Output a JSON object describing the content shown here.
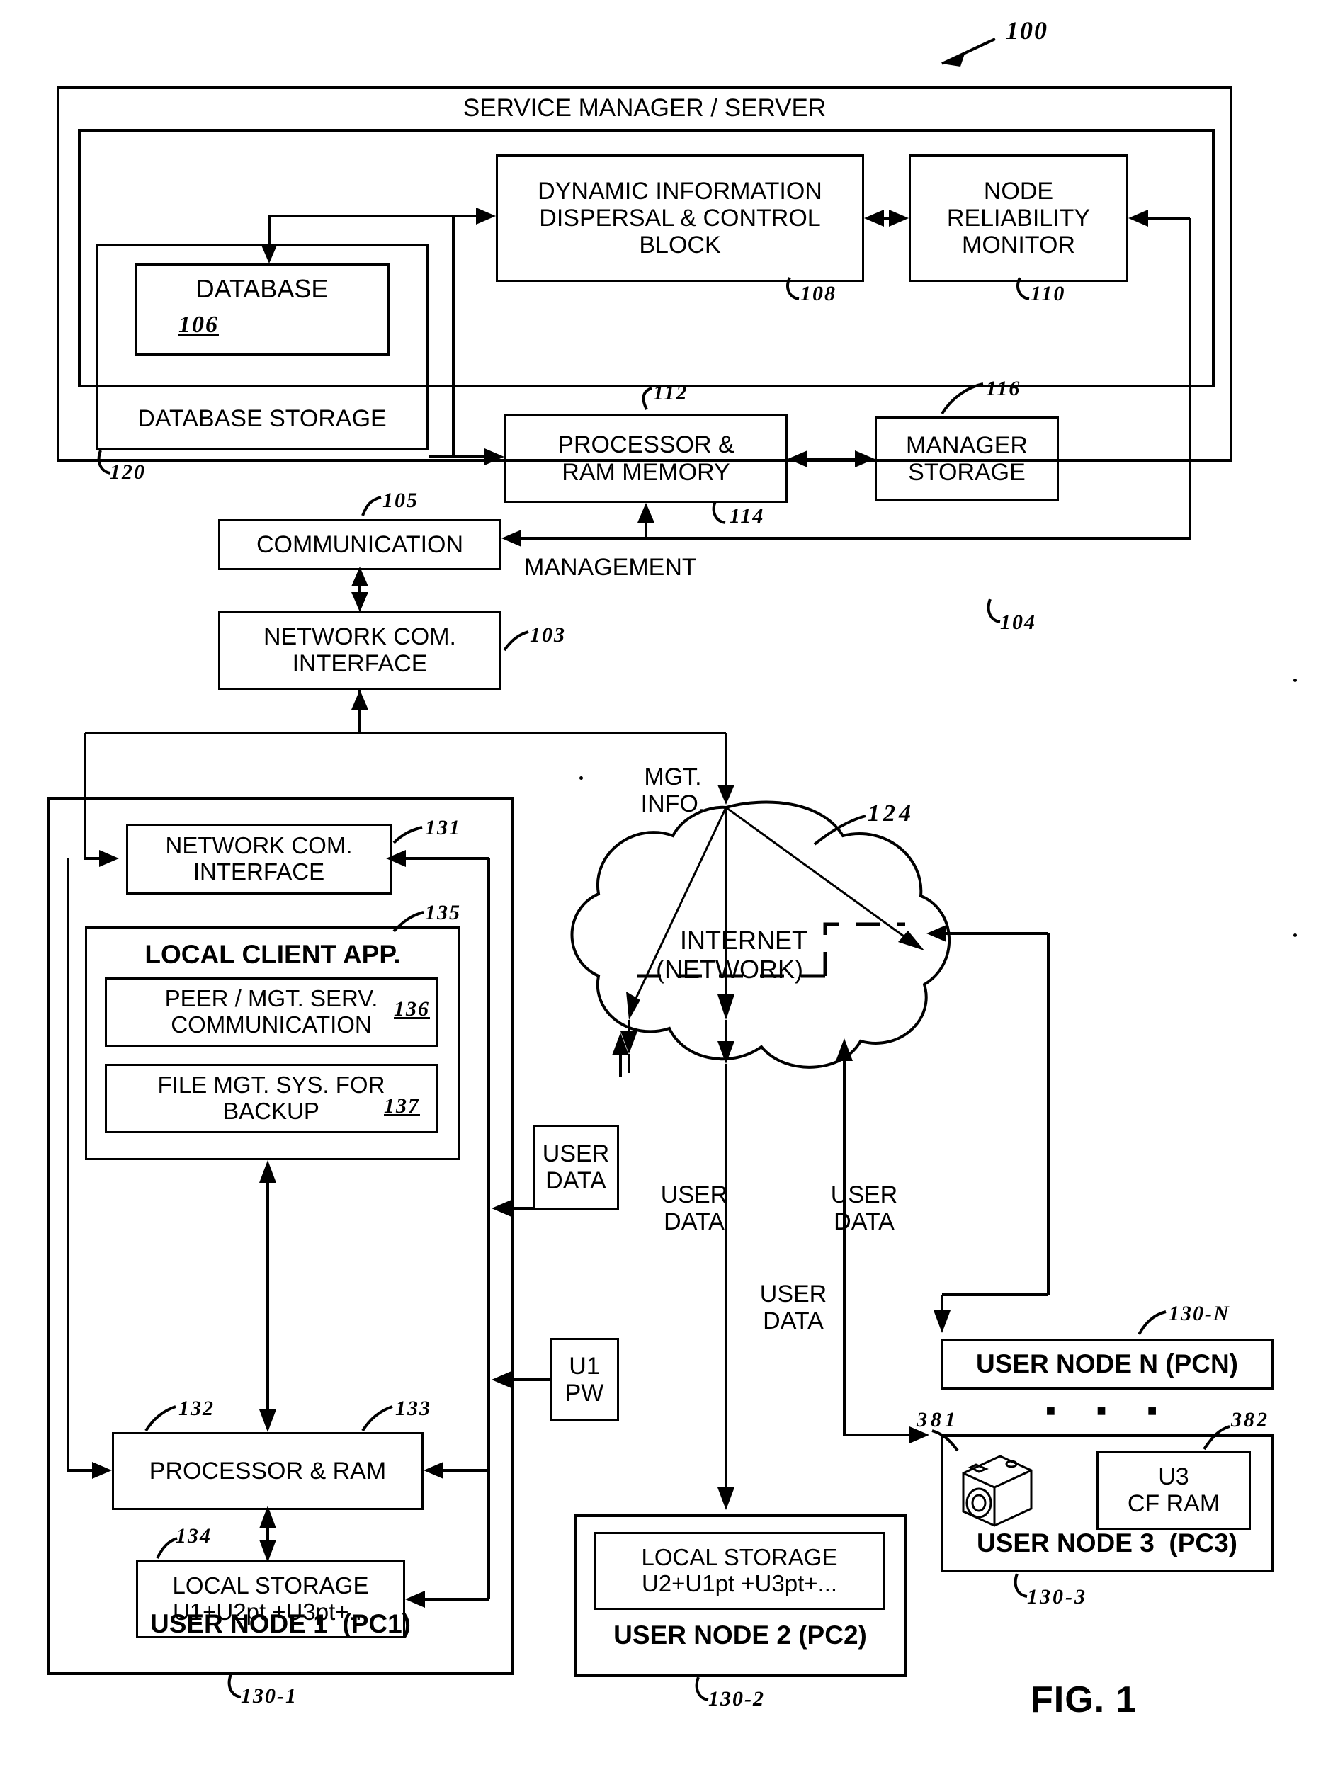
{
  "figure": {
    "label": "FIG. 1",
    "system_ref": "100"
  },
  "server": {
    "title": "SERVICE MANAGER / SERVER",
    "outer_ref": "104",
    "blocks": {
      "dispersal": {
        "text": "DYNAMIC INFORMATION\nDISPERSAL & CONTROL\nBLOCK",
        "ref": "108"
      },
      "reliability": {
        "text": "NODE\nRELIABILITY\nMONITOR",
        "ref": "110"
      },
      "database": {
        "text": "DATABASE",
        "ref": "106"
      },
      "database_storage": {
        "text": "DATABASE STORAGE",
        "ref": "120"
      },
      "processor": {
        "text": "PROCESSOR &\nRAM MEMORY",
        "ref_top": "112",
        "ref_bottom": "114"
      },
      "manager_storage": {
        "text": "MANAGER\nSTORAGE",
        "ref": "116"
      },
      "communication": {
        "text": "COMMUNICATION",
        "ref": "105"
      },
      "network_com_interface": {
        "text": "NETWORK COM.\nINTERFACE",
        "ref": "103"
      }
    },
    "management_label": "MANAGEMENT"
  },
  "network": {
    "cloud_text": "INTERNET\n(NETWORK)",
    "cloud_ref": "124",
    "mgt_info_label": "MGT.\nINFO."
  },
  "flow_labels": {
    "user_data_1": "USER\nDATA",
    "user_data_2": "USER\nDATA",
    "user_data_3": "USER\nDATA",
    "user_data_4": "USER\nDATA"
  },
  "node1": {
    "title": "USER NODE 1  (PC1)",
    "ref": "130-1",
    "network_com_interface": {
      "text": "NETWORK COM.\nINTERFACE",
      "ref": "131"
    },
    "local_client_app": {
      "text": "LOCAL CLIENT APP.",
      "ref": "135"
    },
    "peer_mgt": {
      "text": "PEER / MGT. SERV.\nCOMMUNICATION",
      "ref": "136"
    },
    "file_mgt": {
      "text": "FILE MGT. SYS. FOR\nBACKUP",
      "ref": "137"
    },
    "processor": {
      "text": "PROCESSOR & RAM",
      "ref_left": "132",
      "ref_right": "133"
    },
    "local_storage": {
      "text": "LOCAL STORAGE\nU1+U2pt +U3pt+...",
      "ref": "134"
    },
    "password_box": {
      "text": "U1\nPW"
    }
  },
  "node2": {
    "title": "USER NODE 2 (PC2)",
    "ref": "130-2",
    "local_storage": {
      "text": "LOCAL STORAGE\nU2+U1pt +U3pt+..."
    }
  },
  "nodeN": {
    "title": "USER NODE N  (PCN)",
    "ref": "130-N"
  },
  "node3": {
    "title": "USER NODE 3  (PC3)",
    "ref": "130-3",
    "camera_icon_ref": "381",
    "cf_ram": {
      "text": "U3\nCF RAM",
      "ref": "382"
    },
    "ellipsis": "■   ■   ■"
  },
  "colors": {
    "ink": "#000000",
    "paper": "#ffffff"
  }
}
